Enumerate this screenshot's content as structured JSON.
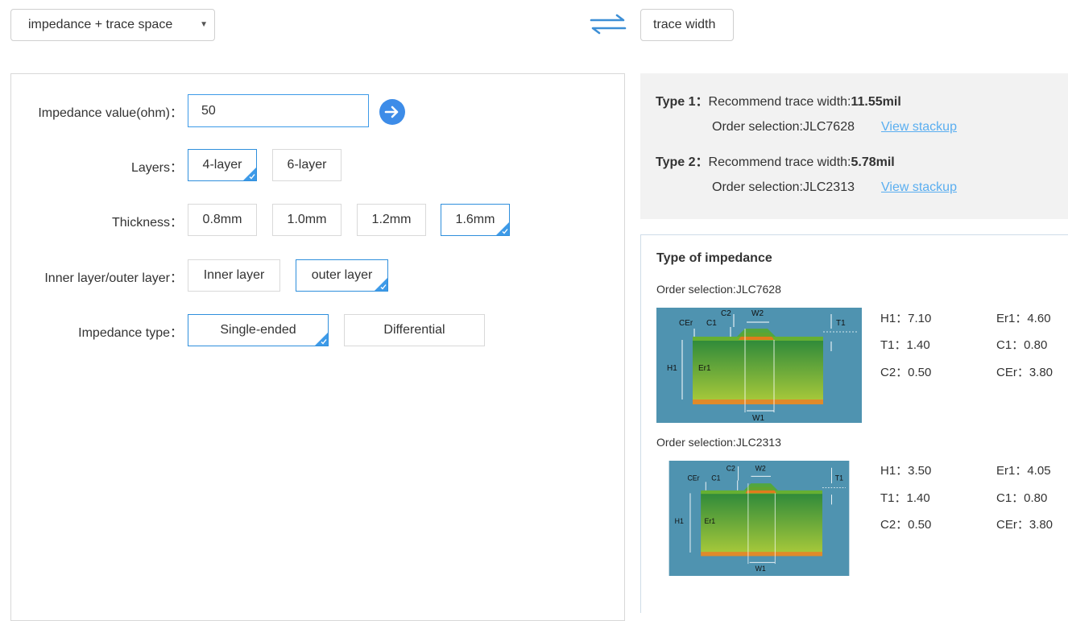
{
  "top": {
    "mode_select": "impedance + trace space",
    "swap_icon": "swap-arrows-icon",
    "target_button": "trace width"
  },
  "form": {
    "impedance_label": "Impedance value(ohm)：",
    "impedance_value": "50",
    "go_icon": "arrow-right-circle-icon",
    "layers_label": "Layers：",
    "layers": [
      "4-layer",
      "6-layer"
    ],
    "layers_selected": "4-layer",
    "thickness_label": "Thickness：",
    "thickness": [
      "0.8mm",
      "1.0mm",
      "1.2mm",
      "1.6mm"
    ],
    "thickness_selected": "1.6mm",
    "inout_label": "Inner layer/outer layer：",
    "inout": [
      "Inner layer",
      "outer layer"
    ],
    "inout_selected": "outer layer",
    "imptype_label": "Impedance type：",
    "imptype": [
      "Single-ended",
      "Differential"
    ],
    "imptype_selected": "Single-ended",
    "check_icon": "checkmark-icon"
  },
  "results": [
    {
      "type_label": "Type 1：",
      "recommend_prefix": "Recommend trace width:",
      "recommend_value": "11.55mil",
      "order_text": "Order selection:JLC7628",
      "link": "View stackup"
    },
    {
      "type_label": "Type 2：",
      "recommend_prefix": "Recommend trace width:",
      "recommend_value": "5.78mil",
      "order_text": "Order selection:JLC2313",
      "link": "View stackup"
    }
  ],
  "impedance_types": {
    "title": "Type of impedance",
    "diagram_labels": [
      "CEr",
      "C1",
      "C2",
      "W2",
      "T1",
      "H1",
      "Er1",
      "W1"
    ],
    "entries": [
      {
        "order": "Order selection:JLC7628",
        "params": [
          [
            "H1：7.10",
            "Er1：4.60"
          ],
          [
            "T1：1.40",
            "C1：0.80"
          ],
          [
            "C2：0.50",
            "CEr：3.80"
          ]
        ]
      },
      {
        "order": "Order selection:JLC2313",
        "params": [
          [
            "H1：3.50",
            "Er1：4.05"
          ],
          [
            "T1：1.40",
            "C1：0.80"
          ],
          [
            "C2：0.50",
            "CEr：3.80"
          ]
        ]
      }
    ]
  },
  "colors": {
    "accent": "#3d9ae8",
    "link": "#5aaef0",
    "diagram_bg": "#4f93b0",
    "board_green": "#3f9a3f",
    "copper": "#e07b1c"
  }
}
